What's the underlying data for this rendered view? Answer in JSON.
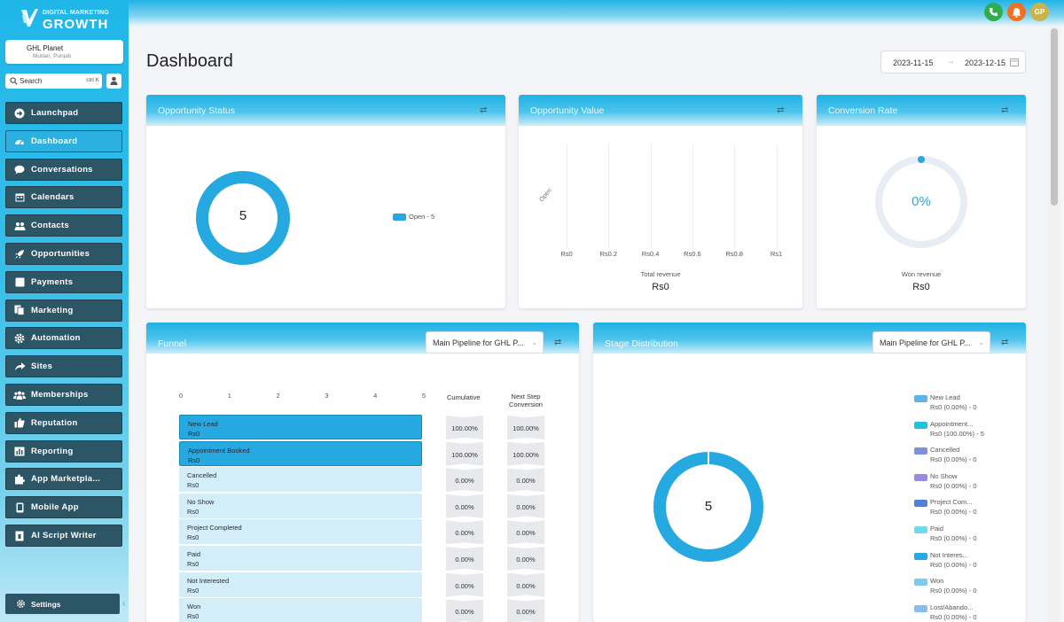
{
  "brand": {
    "line1": "DIGITAL MARKETING",
    "line2": "GROWTH"
  },
  "account": {
    "name": "GHL Planet",
    "location": "Multan, Punjab"
  },
  "search": {
    "placeholder": "Search",
    "shortcut": "ctrl K"
  },
  "nav": [
    {
      "label": "Launchpad",
      "icon": "arrow-right-circle-icon",
      "active": false
    },
    {
      "label": "Dashboard",
      "icon": "dashboard-icon",
      "active": true
    },
    {
      "label": "Conversations",
      "icon": "chat-bubble-icon",
      "active": false
    },
    {
      "label": "Calendars",
      "icon": "calendar-icon",
      "active": false
    },
    {
      "label": "Contacts",
      "icon": "users-icon",
      "active": false
    },
    {
      "label": "Opportunities",
      "icon": "rocket-icon",
      "active": false
    },
    {
      "label": "Payments",
      "icon": "credit-card-icon",
      "active": false
    },
    {
      "label": "Marketing",
      "icon": "copy-icon",
      "active": false
    },
    {
      "label": "Automation",
      "icon": "gear-icon",
      "active": false
    },
    {
      "label": "Sites",
      "icon": "share-icon",
      "active": false
    },
    {
      "label": "Memberships",
      "icon": "group-icon",
      "active": false
    },
    {
      "label": "Reputation",
      "icon": "thumbs-up-icon",
      "active": false
    },
    {
      "label": "Reporting",
      "icon": "bar-chart-icon",
      "active": false
    },
    {
      "label": "App Marketpla...",
      "icon": "puzzle-icon",
      "active": false
    },
    {
      "label": "Mobile App",
      "icon": "mobile-icon",
      "active": false
    },
    {
      "label": "AI Script Writer",
      "icon": "document-icon",
      "active": false
    }
  ],
  "settings": {
    "label": "Settings"
  },
  "topbar": {
    "avatar_initials": "GP",
    "phone_color": "#2eae4f",
    "bell_color": "#f37021",
    "avatar_color": "#c9b34a"
  },
  "page": {
    "title": "Dashboard",
    "date_start": "2023-11-15",
    "date_end": "2023-12-15",
    "date_arrow": "→"
  },
  "cards": {
    "opportunity_status": {
      "title": "Opportunity Status",
      "total": "5",
      "legend": "Open - 5"
    },
    "opportunity_value": {
      "title": "Opportunity Value",
      "y_label": "Open",
      "x_ticks": [
        "Rs0",
        "Rs0.2",
        "Rs0.4",
        "Rs0.6",
        "Rs0.8",
        "Rs1"
      ],
      "caption": "Total revenue",
      "total": "Rs0"
    },
    "conversion_rate": {
      "title": "Conversion Rate",
      "value": "0%",
      "caption": "Won revenue",
      "total": "Rs0"
    },
    "funnel": {
      "title": "Funnel",
      "pipeline": "Main Pipeline for GHL P...",
      "axis": [
        "0",
        "1",
        "2",
        "3",
        "4",
        "5"
      ],
      "col_cumulative": "Cumulative",
      "col_next_1": "Next Step",
      "col_next_2": "Conversion",
      "rows": [
        {
          "stage": "New Lead",
          "revenue": "Rs0",
          "cumulative": "100.00%",
          "next": "100.00%",
          "filled": true
        },
        {
          "stage": "Appointment Booked",
          "revenue": "Rs0",
          "cumulative": "100.00%",
          "next": "100.00%",
          "filled": true
        },
        {
          "stage": "Cancelled",
          "revenue": "Rs0",
          "cumulative": "0.00%",
          "next": "0.00%",
          "filled": false
        },
        {
          "stage": "No Show",
          "revenue": "Rs0",
          "cumulative": "0.00%",
          "next": "0.00%",
          "filled": false
        },
        {
          "stage": "Project Completed",
          "revenue": "Rs0",
          "cumulative": "0.00%",
          "next": "0.00%",
          "filled": false
        },
        {
          "stage": "Paid",
          "revenue": "Rs0",
          "cumulative": "0.00%",
          "next": "0.00%",
          "filled": false
        },
        {
          "stage": "Not Interested",
          "revenue": "Rs0",
          "cumulative": "0.00%",
          "next": "0.00%",
          "filled": false
        },
        {
          "stage": "Won",
          "revenue": "Rs0",
          "cumulative": "0.00%",
          "next": "0.00%",
          "filled": false
        }
      ]
    },
    "stage_distribution": {
      "title": "Stage Distribution",
      "pipeline": "Main Pipeline for GHL P...",
      "total": "5",
      "legend": [
        {
          "name": "New Lead",
          "value": "Rs0 (0.00%) - 0",
          "color": "#5db4ec"
        },
        {
          "name": "Appointment...",
          "value": "Rs0 (100.00%) - 5",
          "color": "#21c3dc"
        },
        {
          "name": "Cancelled",
          "value": "Rs0 (0.00%) - 0",
          "color": "#7d8fe0"
        },
        {
          "name": "No Show",
          "value": "Rs0 (0.00%) - 0",
          "color": "#9a8be0"
        },
        {
          "name": "Project Com...",
          "value": "Rs0 (0.00%) - 0",
          "color": "#4f7fd8"
        },
        {
          "name": "Paid",
          "value": "Rs0 (0.00%) - 0",
          "color": "#6fd9ee"
        },
        {
          "name": "Not Interes...",
          "value": "Rs0 (0.00%) - 0",
          "color": "#25a9e0"
        },
        {
          "name": "Won",
          "value": "Rs0 (0.00%) - 0",
          "color": "#76cdf0"
        },
        {
          "name": "Lost/Abando...",
          "value": "Rs0 (0.00%) - 0",
          "color": "#87bdf0"
        }
      ]
    }
  },
  "colors": {
    "accent": "#25a9e0",
    "sidebar_item": "#2c5566",
    "funnel_light": "#d3eef8"
  }
}
